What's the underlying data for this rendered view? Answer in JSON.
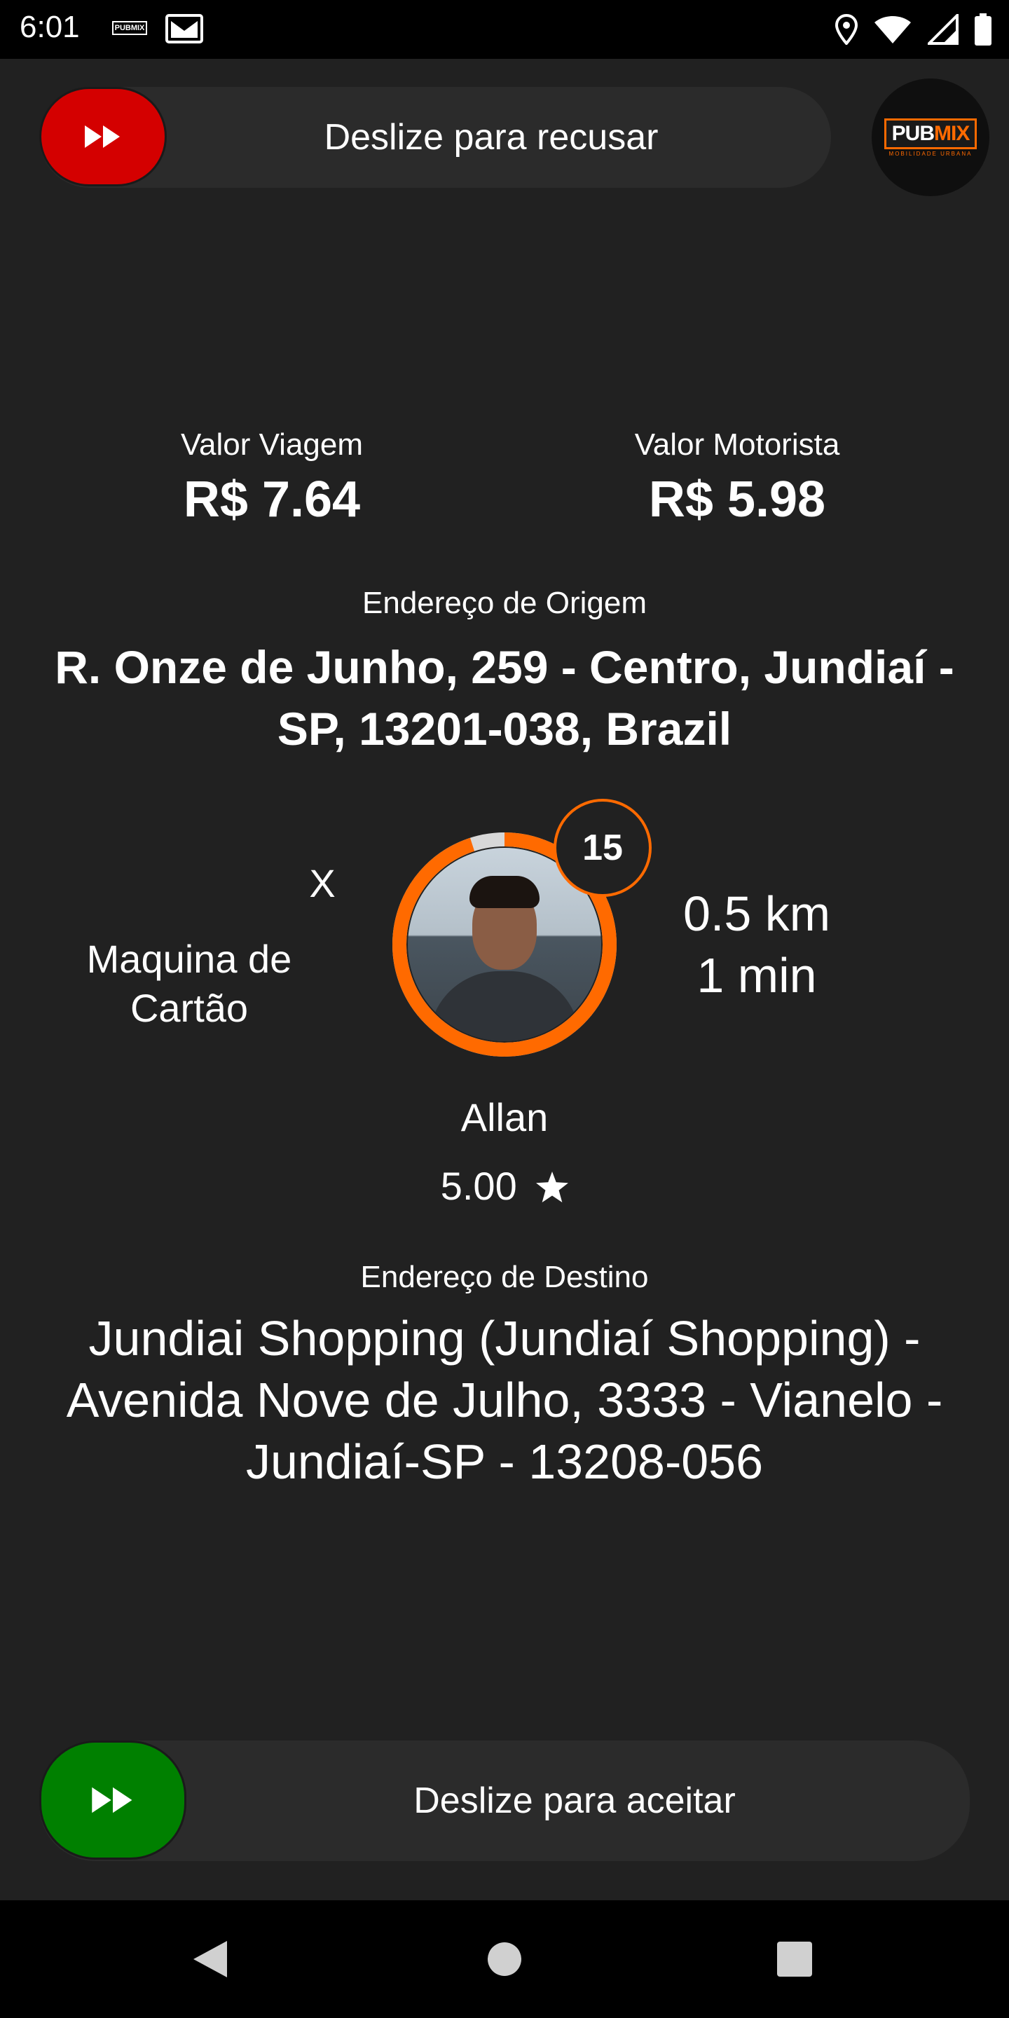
{
  "status_bar": {
    "time": "6:01",
    "notification_icons": [
      "pubmix-notification-icon",
      "gmail-icon"
    ],
    "pubmix_text": "PUBMIX",
    "right_icons": [
      "location-icon",
      "wifi-icon",
      "signal-icon",
      "battery-icon"
    ]
  },
  "reject_slider": {
    "label": "Deslize para recusar",
    "knob_icon": "fast-forward-icon",
    "color": "#d40000"
  },
  "brand": {
    "pub": "PUB",
    "mix": "MIX",
    "subtitle": "MOBILIDADE URBANA",
    "accent": "#ff6a00"
  },
  "fare": {
    "trip_label": "Valor Viagem",
    "trip_value": "R$ 7.64",
    "driver_label": "Valor Motorista",
    "driver_value": "R$ 5.98"
  },
  "origin": {
    "label": "Endereço de Origem",
    "address": "R. Onze de Junho, 259 - Centro, Jundiaí - SP, 13201-038, Brazil"
  },
  "payment": {
    "x_label": "X",
    "method": "Maquina de Cartão"
  },
  "timer": {
    "count": "15",
    "progress": 0.95,
    "ring_color": "#ff6a00"
  },
  "distance": {
    "km": "0.5 km",
    "time": "1 min"
  },
  "passenger": {
    "name": "Allan",
    "rating": "5.00"
  },
  "destination": {
    "label": "Endereço de Destino",
    "address": "Jundiai Shopping (Jundiaí Shopping) - Avenida Nove de Julho, 3333 - Vianelo - Jundiaí-SP - 13208-056"
  },
  "accept_slider": {
    "label": "Deslize para aceitar",
    "knob_icon": "fast-forward-icon",
    "color": "#008000"
  },
  "nav_bar": {
    "buttons": [
      "back-icon",
      "home-icon",
      "recents-icon"
    ]
  }
}
